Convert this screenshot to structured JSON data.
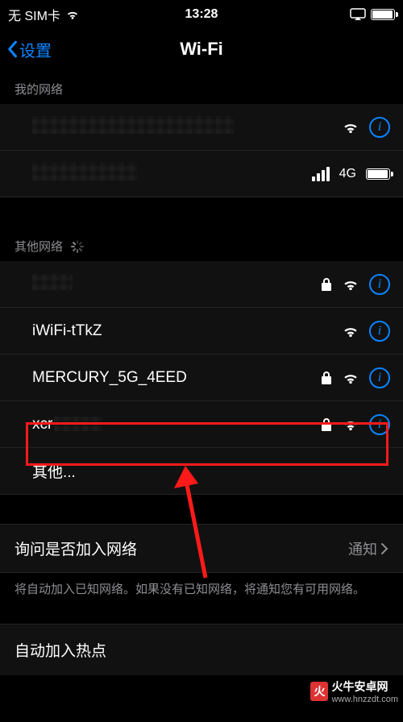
{
  "status": {
    "carrier": "无 SIM卡",
    "time": "13:28"
  },
  "nav": {
    "back": "设置",
    "title": "Wi-Fi"
  },
  "sections": {
    "my_networks": "我的网络",
    "other_networks": "其他网络"
  },
  "my_networks": [
    {
      "name_hidden": true,
      "signal_badge": "4G"
    }
  ],
  "other_networks": [
    {
      "name": "",
      "name_hidden": true,
      "locked": true
    },
    {
      "name": "iWiFi-tTkZ",
      "locked": false
    },
    {
      "name": "MERCURY_5G_4EED",
      "locked": true
    },
    {
      "name": "xcr",
      "name_partial_hidden": true,
      "locked": true,
      "highlighted": true
    }
  ],
  "other_row": "其他...",
  "ask_join": {
    "label": "询问是否加入网络",
    "value": "通知"
  },
  "ask_join_note": "将自动加入已知网络。如果没有已知网络，将通知您有可用网络。",
  "auto_join_hotspot": "自动加入热点",
  "watermark": {
    "brand": "火牛安卓网",
    "url": "www.hnzzdt.com"
  }
}
